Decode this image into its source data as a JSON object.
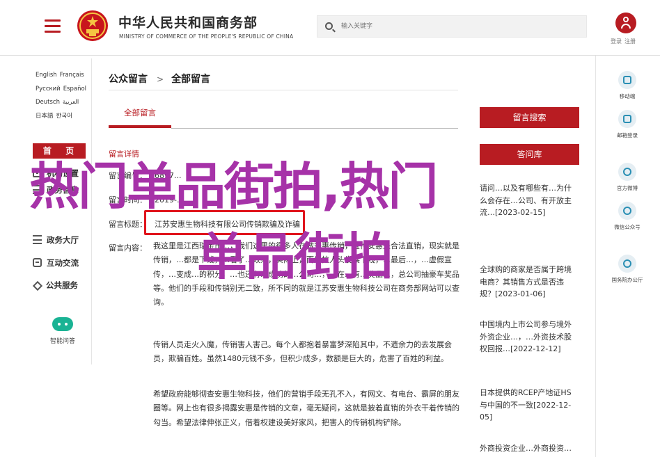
{
  "header": {
    "ministry_cn": "中华人民共和国商务部",
    "ministry_en": "MINISTRY OF COMMERCE OF THE PEOPLE'S REPUBLIC OF CHINA",
    "search_placeholder": "输入关键字",
    "login": "登录",
    "register": "注册",
    "accent_color": "#b81c22"
  },
  "left_nav": {
    "languages": [
      "English",
      "Français",
      "Русский",
      "Español",
      "Deutsch",
      "العربية",
      "日本語",
      "한국어"
    ],
    "home": "首 页",
    "items": [
      {
        "label": "机构设置",
        "icon": "grid-icon"
      },
      {
        "label": "政务信息",
        "icon": "list-icon"
      },
      {
        "label": "政务大厅",
        "icon": "list-icon"
      },
      {
        "label": "互动交流",
        "icon": "chat-icon"
      },
      {
        "label": "公共服务",
        "icon": "diamond-icon"
      }
    ],
    "smart_qa": "智能问答"
  },
  "main": {
    "breadcrumb": [
      "公众留言",
      "全部留言"
    ],
    "breadcrumb_sep": ">",
    "tab": "全部留言",
    "section_title": "留言详情",
    "fields": [
      {
        "label": "留言编号：",
        "value": "6897..."
      },
      {
        "label": "留言时间：",
        "value": "2019-..."
      },
      {
        "label": "留言标题：",
        "value": "江苏安惠生物科技有限公司传销欺骗及诈骗"
      }
    ],
    "content_label": "留言内容：",
    "paragraphs": [
      "我这里是江西瑞金市…，我们这里的很多人在做安惠传销，宣传安惠是合法直销，现实就是传销，…都是下线，…看了…效果，实际上，而是拉人头发展下线，…最后…，…虚假宣传，…变成…的积分，…也还有…成功的…公司…，…在…有…奖品…，总公司抽豪车奖品等。他们的手段和传销别无二致，所不同的就是江苏安惠生物科技公司在商务部网站可以查询。",
      "传销人员走火入魔，传销害人害己。每个人都抱着暴富梦深陷其中，不遗余力的去发展会员，欺骗百姓。虽然1480元钱不多，但积少成多，数额是巨大的，危害了百姓的利益。",
      "希望政府能够彻查安惠生物科技，他们的营销手段无孔不入，有网文、有电台、霸屏的朋友圈等。网上也有很多揭露安惠是传销的文章，毫无疑问，这就是披着直销的外衣干着传销的勾当。希望法律伸张正义，借着权建设美好家风，把害人的传销机构铲除。"
    ]
  },
  "right_col": {
    "search_button": "留言搜索",
    "faq_button": "答问库",
    "faq_items": [
      "请问…以及有哪些有…为什么会存在…公司、有开放主流…[2023-02-15]",
      "全球购的商家是否属于跨境电商？其销售方式是否违规？[2023-01-06]",
      "中国境内上市公司参与境外外资企业…，…外资技术股权回报…[2022-12-12]",
      "日本提供的RCEP产地证HS与中国的不一致[2022-12-05]",
      "外商投资企业…外商投资…"
    ]
  },
  "right_bar": [
    {
      "label": "移动端",
      "icon": "mobile-icon"
    },
    {
      "label": "邮箱登录",
      "icon": "mail-icon"
    },
    {
      "label": "官方微博",
      "icon": "weibo-icon"
    },
    {
      "label": "微信公众号",
      "icon": "wechat-icon"
    },
    {
      "label": "国务院办公厅",
      "icon": "at-icon"
    }
  ],
  "overlay": {
    "line1": "热门单品街拍,热门",
    "line2": "单品街拍",
    "color": "#a632a8"
  }
}
